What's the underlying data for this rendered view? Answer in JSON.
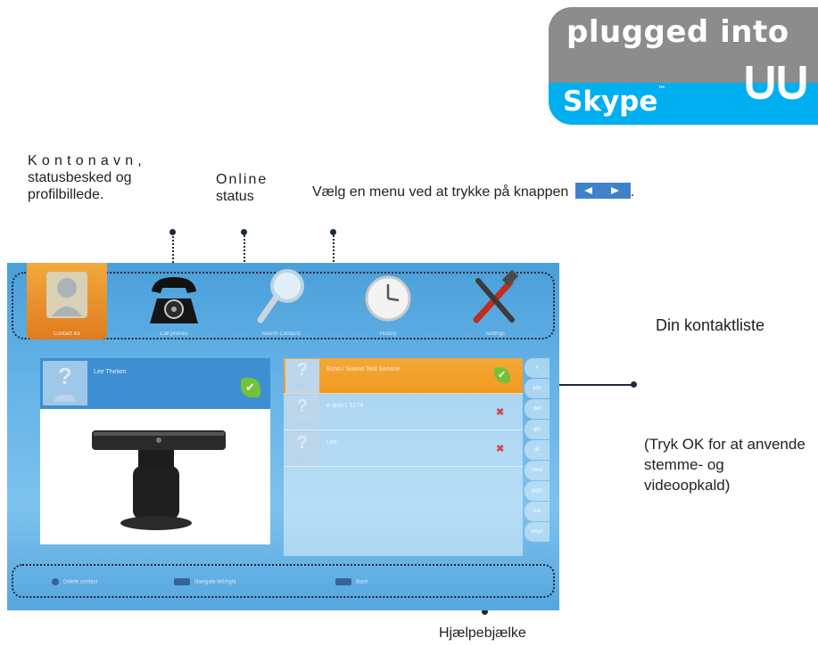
{
  "logo": {
    "line1": "plugged into",
    "line2": "Skype",
    "tm": "™"
  },
  "annotations": {
    "account_first": "Kontonavn,",
    "account_rest1": "statusbesked og",
    "account_rest2": "profilbillede.",
    "online1": "Online",
    "online2": "status",
    "menu_hint": "Vælg en menu ved at trykke på knappen",
    "menu_hint_end": ".",
    "contacts_title": "Din kontaktliste",
    "tryk": "(Tryk OK for at anvende stemme- og videoopkald)",
    "help_bar": "Hjælpebjælke"
  },
  "screen": {
    "menu": [
      {
        "label": "Contact list",
        "icon": "person-icon",
        "active": true
      },
      {
        "label": "Call phones",
        "icon": "telephone-icon",
        "active": false
      },
      {
        "label": "Search Contacts",
        "icon": "magnifier-icon",
        "active": false
      },
      {
        "label": "History",
        "icon": "clock-icon",
        "active": false
      },
      {
        "label": "Settings",
        "icon": "tools-icon",
        "active": false
      }
    ],
    "profile": {
      "name": "Lee Thelion",
      "status": "online"
    },
    "contacts": [
      {
        "name": "Echo / Sound Test Service",
        "status": "online",
        "selected": true
      },
      {
        "name": "e-dnm1 5174",
        "status": "offline",
        "selected": false
      },
      {
        "name": "Lee",
        "status": "offline",
        "selected": false
      }
    ],
    "index": [
      "#",
      "abc",
      "def",
      "ghi",
      "jkl",
      "mno",
      "pqrs",
      "tuv",
      "wxyz"
    ],
    "help": [
      {
        "label": "Delete contact",
        "icon": "circle-button-icon"
      },
      {
        "label": "Navigate left/right",
        "icon": "arrow-keys-icon"
      },
      {
        "label": "Back",
        "icon": "back-key-icon"
      }
    ]
  },
  "colors": {
    "skype_blue": "#00aff0",
    "logo_gray": "#8c8c8c",
    "screen_blue": "#5aaae2",
    "selected_orange": "#f19a22",
    "online_green": "#72c23a"
  }
}
